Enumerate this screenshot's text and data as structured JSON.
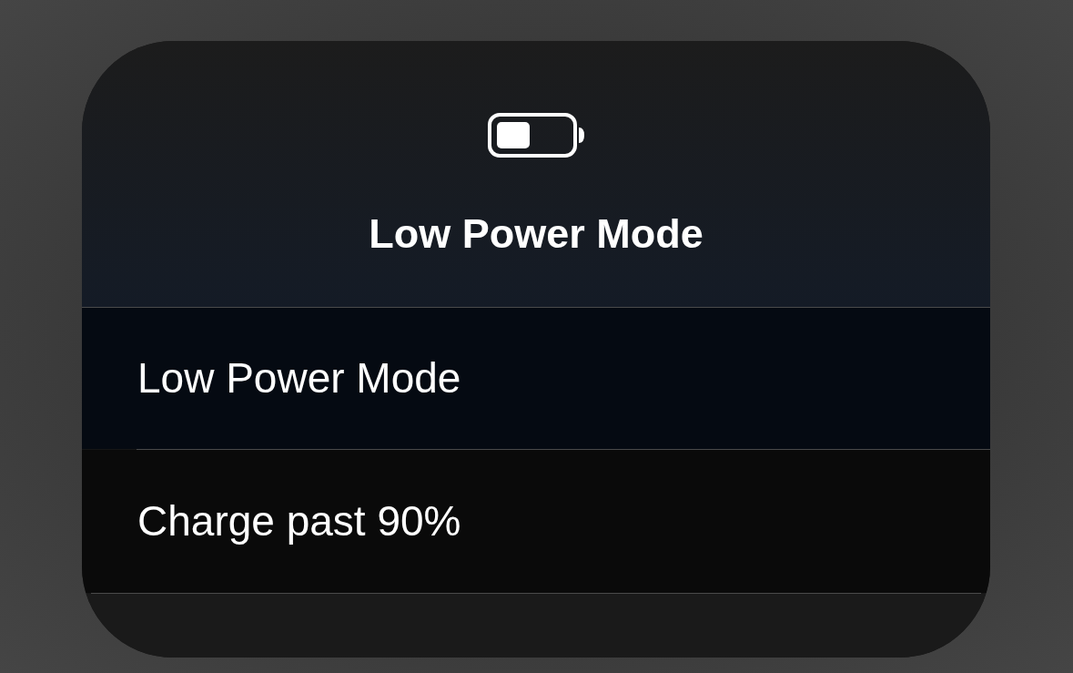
{
  "menu": {
    "title": "Low Power Mode",
    "items": [
      {
        "label": "Low Power Mode"
      },
      {
        "label": "Charge past 90%"
      }
    ]
  }
}
